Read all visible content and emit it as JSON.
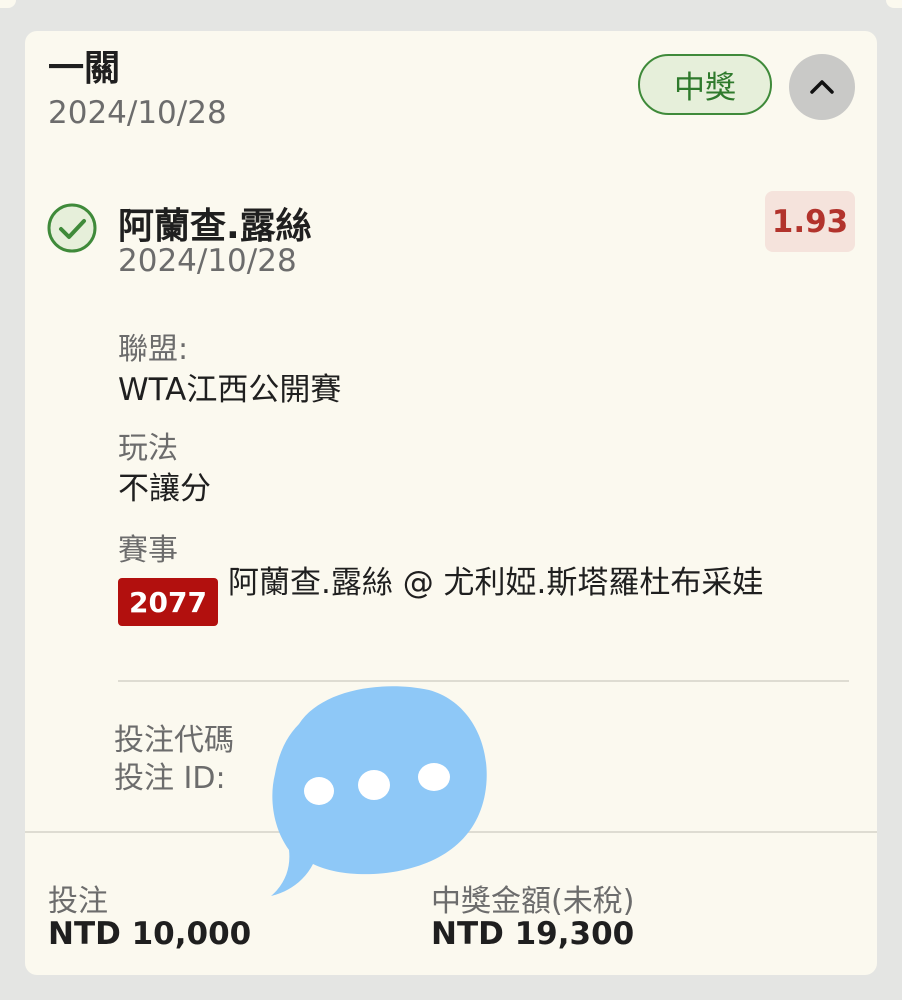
{
  "bet": {
    "type": "一關",
    "date": "2024/10/28",
    "status": "中獎"
  },
  "selection": {
    "name": "阿蘭查.露絲",
    "date": "2024/10/28",
    "odds": "1.93",
    "league_label": "聯盟:",
    "league": "WTA江西公開賽",
    "market_label": "玩法",
    "market": "不讓分",
    "event_label": "賽事",
    "event_code": "2077",
    "event_name": "阿蘭查.露絲 @ 尤利婭.斯塔羅杜布采娃"
  },
  "reference": {
    "code_label": "投注代碼",
    "id_label": "投注 ID:"
  },
  "summary": {
    "stake_label": "投注",
    "stake": "NTD 10,000",
    "payout_label": "中獎金額(未稅)",
    "payout": "NTD 19,300"
  },
  "colors": {
    "card_background": "#fbf9ef",
    "win_green": "#3f8a3a",
    "odds_red": "#b2332c",
    "event_code_red": "#b2100e",
    "overlay_blue": "#8ec8f7"
  },
  "icons": {
    "collapse": "chevron-up-icon",
    "result": "check-circle-icon",
    "overlay": "speech-bubble-icon"
  }
}
